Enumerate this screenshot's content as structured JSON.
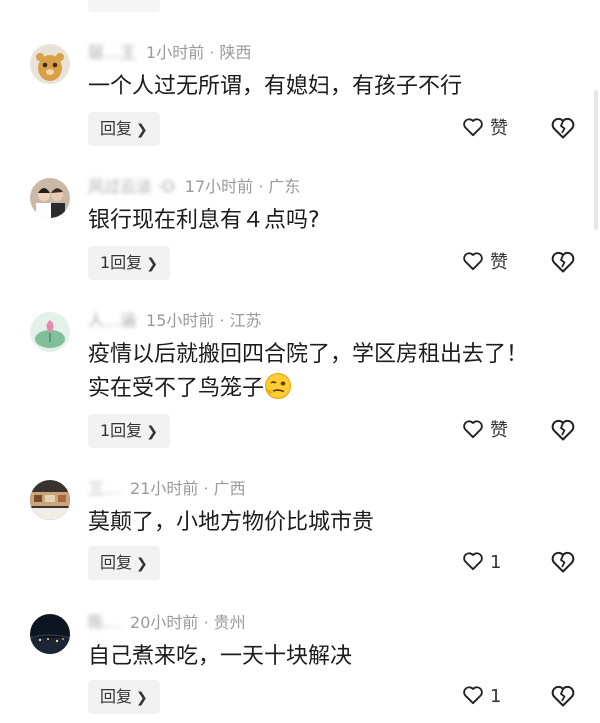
{
  "comments": [
    {
      "username": "层…王",
      "meta": "1小时前 · 陕西",
      "lines": [
        "一个人过无所谓，有媳妇，有孩子不行"
      ],
      "reply": "回复",
      "like": "赞"
    },
    {
      "username": "风过云淡 ·O",
      "meta": "17小时前 · 广东",
      "lines": [
        "银行现在利息有４点吗?"
      ],
      "reply": "1回复",
      "like": "赞"
    },
    {
      "username": "人…涵",
      "meta": "15小时前 · 江苏",
      "lines": [
        "疫情以后就搬回四合院了，学区房租出去了！",
        "实在受不了鸟笼子"
      ],
      "reply": "1回复",
      "like": "赞"
    },
    {
      "username": "三…",
      "meta": "21小时前 · 广西",
      "lines": [
        "莫颠了，小地方物价比城市贵"
      ],
      "reply": "回复",
      "like": "1"
    },
    {
      "username": "陈…",
      "meta": "20小时前 · 贵州",
      "lines": [
        "自己煮来吃，一天十块解决"
      ],
      "reply": "回复",
      "like": "1"
    }
  ],
  "icons": {
    "reply_chevron": "chevron-right-icon",
    "like": "heart-icon",
    "dislike": "broken-heart-icon",
    "emoji": "wry-smile-emoji"
  }
}
